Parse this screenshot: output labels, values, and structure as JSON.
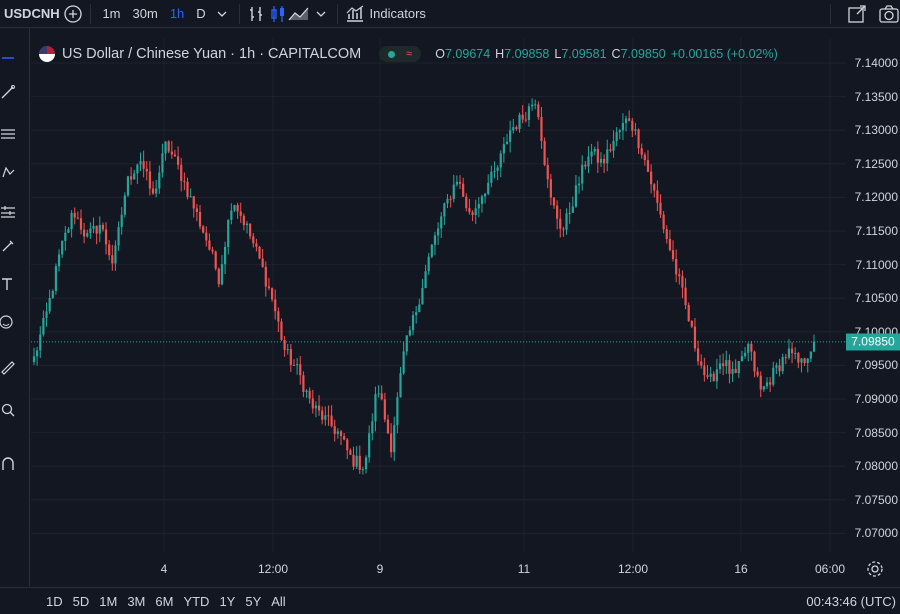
{
  "toolbar": {
    "symbol": "USDCNH",
    "timeframes": [
      "1m",
      "30m",
      "1h",
      "D"
    ],
    "active_timeframe": "1h",
    "indicators_label": "Indicators"
  },
  "legend": {
    "title": "US Dollar / Chinese Yuan · 1h · CAPITALCOM",
    "o_key": "O",
    "o_val": "7.09674",
    "h_key": "H",
    "h_val": "7.09858",
    "l_key": "L",
    "l_val": "7.09581",
    "c_key": "C",
    "c_val": "7.09850",
    "change": "+0.00165 (+0.02%)"
  },
  "last_price": "7.09850",
  "ranges": [
    "1D",
    "5D",
    "1M",
    "3M",
    "6M",
    "YTD",
    "1Y",
    "5Y",
    "All"
  ],
  "clock": "00:43:46 (UTC)",
  "colors": {
    "up": "#26a69a",
    "down": "#ef5350",
    "background": "#131722",
    "accent": "#2962ff"
  },
  "chart_data": {
    "type": "candlestick",
    "y_ticks": [
      "7.14000",
      "7.13500",
      "7.13000",
      "7.12500",
      "7.12000",
      "7.11500",
      "7.11000",
      "7.10500",
      "7.10000",
      "7.09500",
      "7.09000",
      "7.08500",
      "7.08000",
      "7.07500",
      "7.07000"
    ],
    "ylim": [
      7.0665,
      7.1415
    ],
    "x_ticks": [
      "4",
      "12:00",
      "9",
      "11",
      "12:00",
      "16",
      "06:00"
    ],
    "close_path": [
      7.096,
      7.103,
      7.112,
      7.118,
      7.114,
      7.116,
      7.11,
      7.122,
      7.126,
      7.12,
      7.128,
      7.124,
      7.119,
      7.114,
      7.108,
      7.12,
      7.116,
      7.111,
      7.105,
      7.097,
      7.094,
      7.089,
      7.087,
      7.085,
      7.081,
      7.08,
      7.092,
      7.083,
      7.097,
      7.104,
      7.112,
      7.118,
      7.123,
      7.117,
      7.121,
      7.124,
      7.13,
      7.132,
      7.135,
      7.12,
      7.115,
      7.121,
      7.127,
      7.125,
      7.129,
      7.132,
      7.127,
      7.12,
      7.113,
      7.106,
      7.098,
      7.092,
      7.096,
      7.093,
      7.098,
      7.091,
      7.094,
      7.097,
      7.095,
      7.0985
    ]
  }
}
